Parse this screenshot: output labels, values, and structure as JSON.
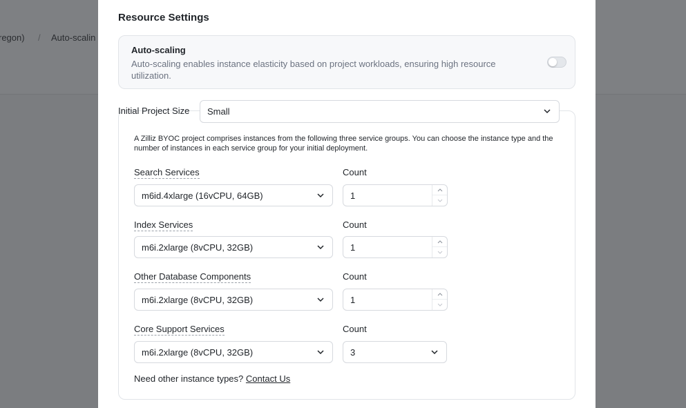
{
  "background": {
    "breadcrumb": [
      "regon)",
      "Auto-scalin"
    ],
    "separator": "/"
  },
  "modal": {
    "title": "Resource Settings",
    "auto_scaling": {
      "title": "Auto-scaling",
      "description": "Auto-scaling enables instance elasticity based on project workloads, ensuring high resource utilization.",
      "enabled": false
    },
    "project_size": {
      "label": "Initial Project Size",
      "value": "Small"
    },
    "groups": {
      "intro": "A Zilliz BYOC project comprises instances from the following three service groups. You can choose the instance type and the number of instances in each service group for your initial deployment.",
      "items": [
        {
          "label": "Search Services",
          "count_label": "Count",
          "instance": "m6id.4xlarge (16vCPU, 64GB)",
          "count": "1"
        },
        {
          "label": "Index Services",
          "count_label": "Count",
          "instance": "m6i.2xlarge (8vCPU, 32GB)",
          "count": "1"
        },
        {
          "label": "Other Database Components",
          "count_label": "Count",
          "instance": "m6i.2xlarge (8vCPU, 32GB)",
          "count": "1"
        },
        {
          "label": "Core Support Services",
          "count_label": "Count",
          "instance": "m6i.2xlarge (8vCPU, 32GB)",
          "count": "3"
        }
      ],
      "footer_text": "Need other instance types?",
      "contact_link": "Contact Us"
    }
  }
}
